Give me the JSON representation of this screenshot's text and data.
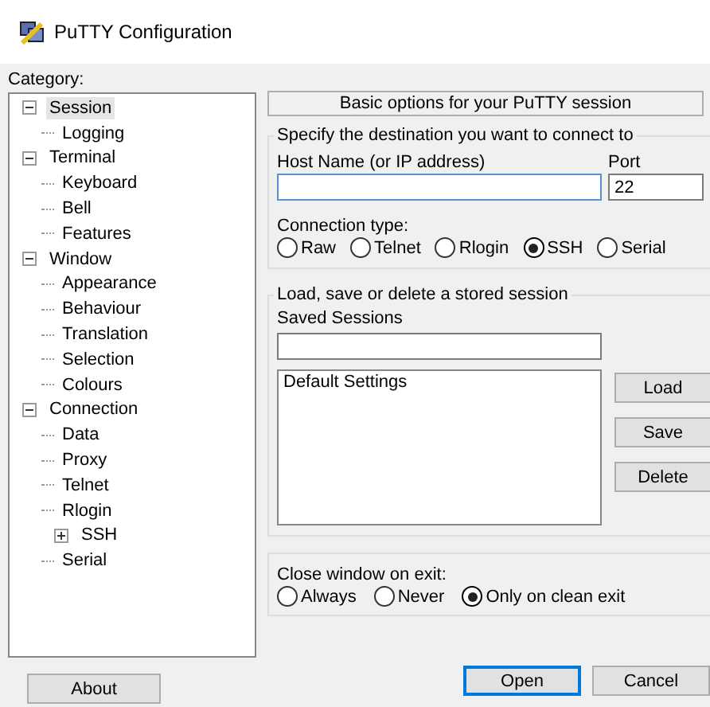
{
  "window": {
    "title": "PuTTY Configuration"
  },
  "category": {
    "label": "Category:",
    "tree": [
      {
        "label": "Session",
        "selected": true,
        "expanded": true,
        "children": [
          {
            "label": "Logging",
            "selected": false
          }
        ]
      },
      {
        "label": "Terminal",
        "selected": false,
        "expanded": true,
        "children": [
          {
            "label": "Keyboard",
            "selected": false
          },
          {
            "label": "Bell",
            "selected": false
          },
          {
            "label": "Features",
            "selected": false
          }
        ]
      },
      {
        "label": "Window",
        "selected": false,
        "expanded": true,
        "children": [
          {
            "label": "Appearance",
            "selected": false
          },
          {
            "label": "Behaviour",
            "selected": false
          },
          {
            "label": "Translation",
            "selected": false
          },
          {
            "label": "Selection",
            "selected": false
          },
          {
            "label": "Colours",
            "selected": false
          }
        ]
      },
      {
        "label": "Connection",
        "selected": false,
        "expanded": true,
        "children": [
          {
            "label": "Data",
            "selected": false
          },
          {
            "label": "Proxy",
            "selected": false
          },
          {
            "label": "Telnet",
            "selected": false
          },
          {
            "label": "Rlogin",
            "selected": false
          },
          {
            "label": "SSH",
            "selected": false,
            "expanded": false
          },
          {
            "label": "Serial",
            "selected": false
          }
        ]
      }
    ]
  },
  "panel": {
    "header": "Basic options for your PuTTY session",
    "destination": {
      "legend": "Specify the destination you want to connect to",
      "host_label": "Host Name (or IP address)",
      "port_label": "Port",
      "port_value": "22",
      "type_label": "Connection type:",
      "types": [
        {
          "label": "Raw",
          "selected": false
        },
        {
          "label": "Telnet",
          "selected": false
        },
        {
          "label": "Rlogin",
          "selected": false
        },
        {
          "label": "SSH",
          "selected": true
        },
        {
          "label": "Serial",
          "selected": false
        }
      ]
    },
    "sessions": {
      "legend": "Load, save or delete a stored session",
      "label": "Saved Sessions",
      "items": [
        {
          "label": "Default Settings",
          "selected": false
        }
      ],
      "buttons": [
        "Load",
        "Save",
        "Delete"
      ]
    },
    "close": {
      "label": "Close window on exit:",
      "options": [
        {
          "label": "Always",
          "selected": false
        },
        {
          "label": "Never",
          "selected": false
        },
        {
          "label": "Only on clean exit",
          "selected": true
        }
      ]
    }
  },
  "footer": {
    "about": "About",
    "open": "Open",
    "cancel": "Cancel"
  }
}
